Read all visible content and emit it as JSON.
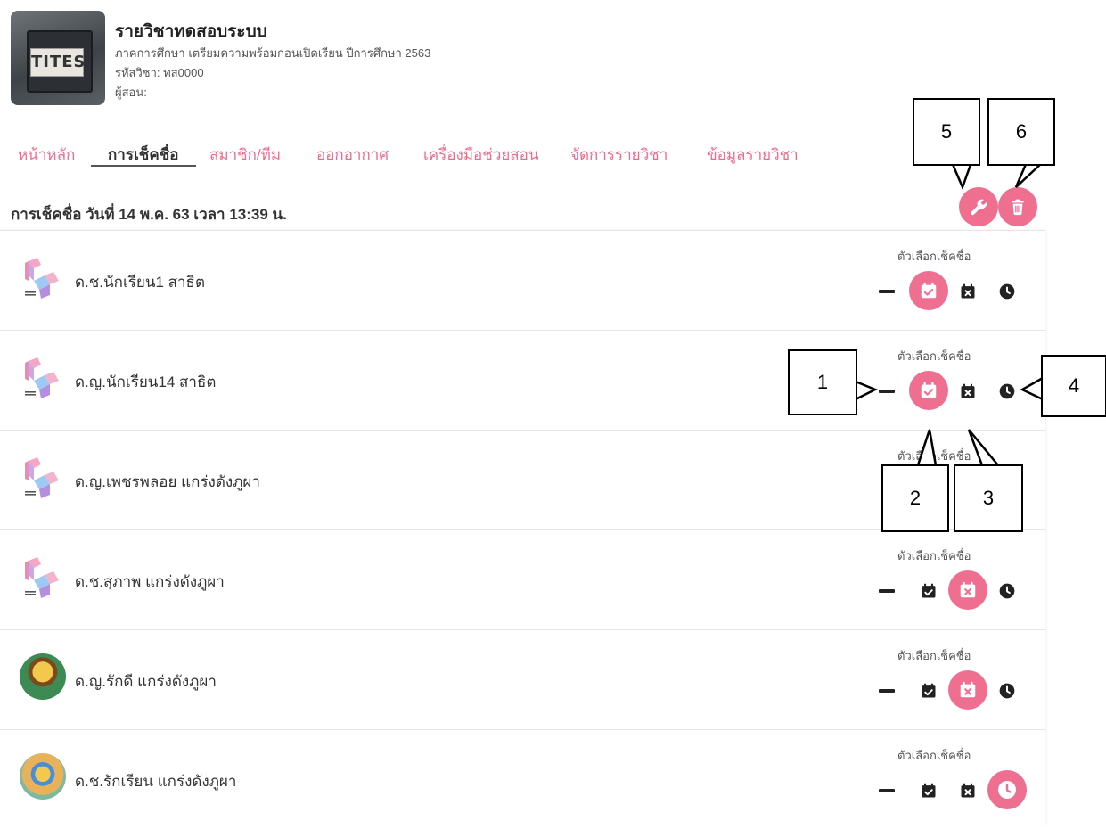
{
  "course": {
    "title": "รายวิชาทดสอบระบบ",
    "semester": "ภาคการศึกษา เตรียมความพร้อมก่อนเปิดเรียน ปีการศึกษา 2563",
    "code": "รหัสวิชา: ทส0000",
    "instructor": "ผู้สอน:",
    "thumb_text": "TITES"
  },
  "tabs": [
    {
      "label": "หน้าหลัก",
      "active": false
    },
    {
      "label": "การเช็คชื่อ",
      "active": true
    },
    {
      "label": "สมาชิก/ทีม",
      "active": false
    },
    {
      "label": "ออกอากาศ",
      "active": false
    },
    {
      "label": "เครื่องมือช่วยสอน",
      "active": false
    },
    {
      "label": "จัดการรายวิชา",
      "active": false
    },
    {
      "label": "ข้อมูลรายวิชา",
      "active": false
    }
  ],
  "session": {
    "title": "การเช็คชื่อ วันที่ 14 พ.ค. 63 เวลา 13:39 น.",
    "settings_icon": "wrench-icon",
    "delete_icon": "trash-icon"
  },
  "students": [
    {
      "name": "ด.ช.นักเรียน1 สาธิต",
      "avatar": "smart-school-logo",
      "option_label": "ตัวเลือกเช็คชื่อ",
      "status": "present"
    },
    {
      "name": "ด.ญ.นักเรียน14 สาธิต",
      "avatar": "smart-school-logo",
      "option_label": "ตัวเลือกเช็คชื่อ",
      "status": "present"
    },
    {
      "name": "ด.ญ.เพชรพลอย แกร่งดังภูผา",
      "avatar": "smart-school-logo",
      "option_label": "ตัวเลือกเช็คชื่อ",
      "status": "none"
    },
    {
      "name": "ด.ช.สุภาพ แกร่งดังภูผา",
      "avatar": "smart-school-logo",
      "option_label": "ตัวเลือกเช็คชื่อ",
      "status": "absent"
    },
    {
      "name": "ด.ญ.รักดี แกร่งดังภูผา",
      "avatar": "photo-avatar",
      "option_label": "ตัวเลือกเช็คชื่อ",
      "status": "absent"
    },
    {
      "name": "ด.ช.รักเรียน แกร่งดังภูผา",
      "avatar": "photo-avatar",
      "option_label": "ตัวเลือกเช็คชื่อ",
      "status": "late"
    }
  ],
  "callouts": [
    "1",
    "2",
    "3",
    "4",
    "5",
    "6"
  ],
  "colors": {
    "accent": "#ef6f90",
    "tab_text": "#ee6b8c",
    "text": "#333333"
  }
}
